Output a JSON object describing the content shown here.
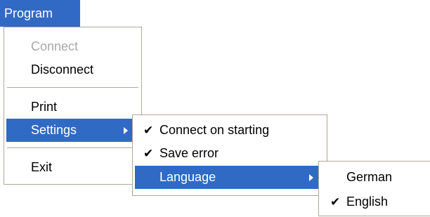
{
  "menubar": {
    "program_label": "Program"
  },
  "program_menu": {
    "items": [
      {
        "label": "Connect",
        "enabled": false
      },
      {
        "label": "Disconnect",
        "enabled": true
      },
      {
        "label": "Print",
        "enabled": true
      },
      {
        "label": "Settings",
        "enabled": true,
        "has_submenu": true,
        "highlighted": true
      },
      {
        "label": "Exit",
        "enabled": true
      }
    ]
  },
  "settings_menu": {
    "items": [
      {
        "label": "Connect on starting",
        "checked": true
      },
      {
        "label": "Save error",
        "checked": true
      },
      {
        "label": "Language",
        "checked": false,
        "has_submenu": true,
        "highlighted": true
      }
    ]
  },
  "language_menu": {
    "items": [
      {
        "label": "German",
        "checked": false
      },
      {
        "label": "English",
        "checked": true
      }
    ]
  },
  "icons": {
    "check": "✔",
    "submenu_arrow": "triangle-right"
  },
  "colors": {
    "highlight": "#316ac5",
    "highlight_text": "#ffffff",
    "disabled_text": "#a8a8a8",
    "menu_border": "#aca899"
  }
}
